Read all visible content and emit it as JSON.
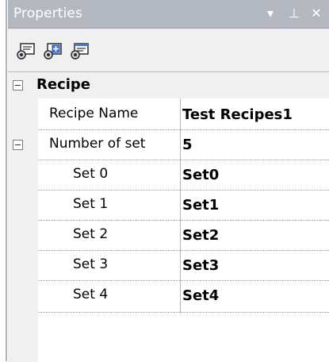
{
  "window": {
    "title": "Properties",
    "controls": {
      "dropdown": "▾",
      "pin": "⊥",
      "close": "✕"
    }
  },
  "toolbar": {
    "buttons": [
      {
        "name": "categorized-icon"
      },
      {
        "name": "add-property-icon"
      },
      {
        "name": "property-pages-icon"
      }
    ]
  },
  "grid": {
    "category": {
      "label": "Recipe",
      "expanded": true
    },
    "rows": [
      {
        "name": "Recipe Name",
        "value": "Test Recipes1"
      },
      {
        "name": "Number of set",
        "value": "5",
        "expanded": true
      },
      {
        "name": "Set 0",
        "value": "Set0"
      },
      {
        "name": "Set 1",
        "value": "Set1"
      },
      {
        "name": "Set 2",
        "value": "Set2"
      },
      {
        "name": "Set 3",
        "value": "Set3"
      },
      {
        "name": "Set 4",
        "value": "Set4"
      }
    ]
  },
  "colors": {
    "titlebar": "#b3b8c1",
    "panel": "#f0f0f0",
    "grid_bg": "#ffffff",
    "separator": "#9b9b9b"
  }
}
